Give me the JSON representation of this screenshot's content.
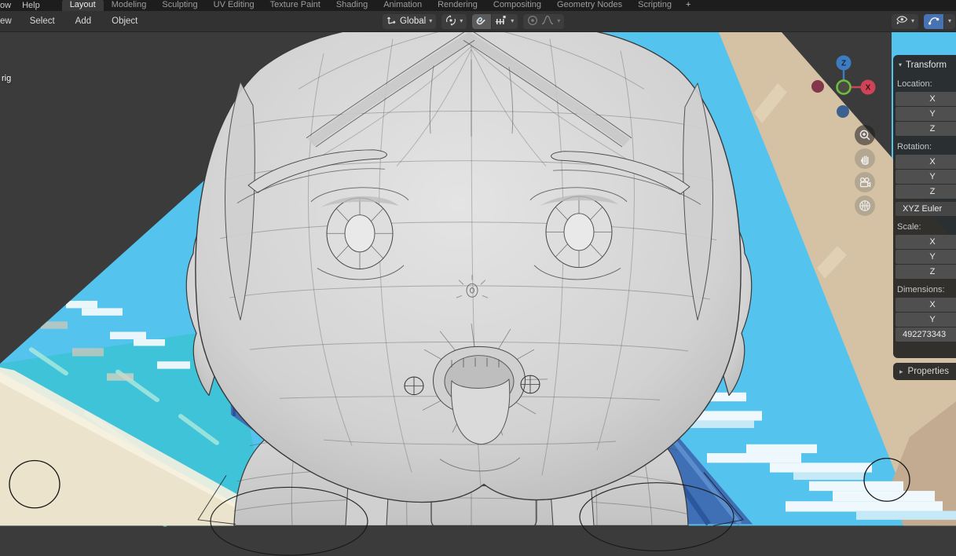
{
  "topbar": {
    "window_menu_clipped": "ow",
    "help_menu": "Help",
    "tabs": [
      "Layout",
      "Modeling",
      "Sculpting",
      "UV Editing",
      "Texture Paint",
      "Shading",
      "Animation",
      "Rendering",
      "Compositing",
      "Geometry Nodes",
      "Scripting"
    ],
    "active_tab": "Layout",
    "new_workspace_button": "+"
  },
  "header": {
    "view_menu_clipped": "ew",
    "select_menu": "Select",
    "add_menu": "Add",
    "object_menu": "Object",
    "transform_orientation": "Global",
    "snapping_enabled": true,
    "overlays_enabled": true
  },
  "viewport": {
    "active_object_label_clipped": "rig",
    "gizmo": {
      "z_label": "Z",
      "x_label": "X"
    }
  },
  "panel": {
    "title": "Transform",
    "location_label": "Location:",
    "rotation_label": "Rotation:",
    "scale_label": "Scale:",
    "dimensions_label": "Dimensions:",
    "x": "X",
    "y": "Y",
    "z": "Z",
    "rotation_mode": "XYZ Euler",
    "dimension_z_value_clipped": "492273343",
    "properties_tab": "Properties"
  },
  "icons": {
    "chevron_down": "▾",
    "chevron_right": "▸",
    "orientation": "axes-glyph",
    "pivot": "orbit-dot-glyph",
    "magnet": "horseshoe-glyph",
    "snap_to": "increment-bars-glyph",
    "proportional": "dot-circle-glyph",
    "falloff": "bell-curve-glyph",
    "show_gizmo": "eye-cursor-glyph",
    "overlays": "arc-dots-glyph",
    "nav": [
      "magnifier-plus",
      "hand",
      "camera",
      "grid-sphere"
    ]
  },
  "colors": {
    "accent_blue": "#4772b3",
    "axis_x_red": "#cc4455",
    "axis_z_blue": "#3e7cc1",
    "axis_y_green": "#6fbf3e",
    "sky": "#54c3ee",
    "water": "#3fc3d8",
    "sand_light": "#ebe3cb",
    "sand_tan": "#d5c2a5",
    "deep_blue_band": "#3f6fb5",
    "towel_salmon": "#f7a28b",
    "mesh_gray": "#d6d6d6",
    "viewport_bg": "#3b3b3b"
  }
}
